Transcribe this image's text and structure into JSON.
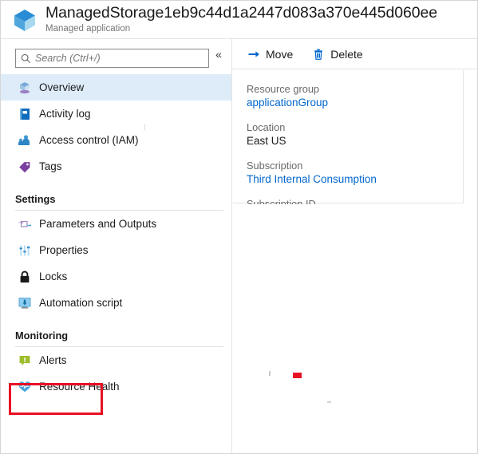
{
  "header": {
    "title": "ManagedStorage1eb9c44d1a2447d083a370e445d060ee",
    "subtitle": "Managed application",
    "icon": "managed-application-cube-icon"
  },
  "sidebar": {
    "search": {
      "placeholder": "Search (Ctrl+/)",
      "value": "",
      "icon": "search-icon"
    },
    "collapse": {
      "glyph": "«",
      "icon": "collapse-chevron-icon"
    },
    "items": [
      {
        "label": "Overview",
        "icon": "overview-icon",
        "selected": true
      },
      {
        "label": "Activity log",
        "icon": "activity-log-icon",
        "selected": false
      },
      {
        "label": "Access control (IAM)",
        "icon": "access-control-icon",
        "selected": false
      },
      {
        "label": "Tags",
        "icon": "tags-icon",
        "selected": false
      }
    ],
    "sections": [
      {
        "title": "Settings",
        "items": [
          {
            "label": "Parameters and Outputs",
            "icon": "parameters-outputs-icon",
            "selected": false
          },
          {
            "label": "Properties",
            "icon": "properties-sliders-icon",
            "selected": false
          },
          {
            "label": "Locks",
            "icon": "lock-icon",
            "selected": false
          },
          {
            "label": "Automation script",
            "icon": "automation-script-icon",
            "selected": false
          }
        ]
      },
      {
        "title": "Monitoring",
        "items": [
          {
            "label": "Alerts",
            "icon": "alerts-icon",
            "selected": false,
            "highlighted": true
          },
          {
            "label": "Resource Health",
            "icon": "resource-health-icon",
            "selected": false
          }
        ]
      }
    ]
  },
  "toolbar": {
    "buttons": [
      {
        "label": "Move",
        "icon": "move-arrow-icon"
      },
      {
        "label": "Delete",
        "icon": "trash-icon"
      }
    ]
  },
  "essentials": [
    {
      "label": "Resource group",
      "value": "applicationGroup",
      "is_link": true
    },
    {
      "label": "Location",
      "value": "East US",
      "is_link": false
    },
    {
      "label": "Subscription",
      "value": "Third Internal Consumption",
      "is_link": true
    },
    {
      "label": "Subscription ID",
      "value": "",
      "is_link": false
    }
  ],
  "colors": {
    "accent_link": "#0066cc",
    "selected_row": "#deecf9",
    "annotation": "#e81123",
    "label_gray": "#696969"
  }
}
